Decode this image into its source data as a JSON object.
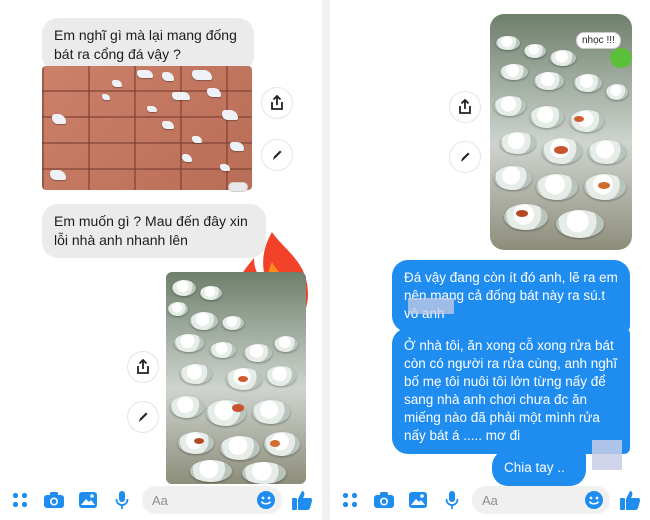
{
  "colors": {
    "accent": "#1f8cf0",
    "incoming_bubble": "#ebebeb",
    "outgoing_bubble": "#1f8cf0"
  },
  "left": {
    "messages": [
      "Em nghĩ gì mà lại mang đống bát ra cổng đá vậy ?",
      "Em muốn gì ? Mau đến đây xin lỗi nhà anh nhanh lên"
    ],
    "reaction_emoji": "🔥",
    "composer": {
      "placeholder": "Aa"
    }
  },
  "right": {
    "sticker_text": "nhọc !!!",
    "messages": [
      "Đá vậy đang còn ít đó anh, lẽ ra em nên mang cả đống bát này ra sú.t vô     anh",
      "Ở nhà tôi, ăn xong cỗ xong rửa bát còn có người ra rửa cùng, anh nghĩ bố mẹ tôi nuôi tôi lớn từng nấy để sang nhà anh chơi chưa đc ăn miếng nào đã phải một mình rửa nấy bát á ..... mơ đi",
      "Chia tay .."
    ],
    "composer": {
      "placeholder": "Aa"
    }
  },
  "icons": {
    "menu": "dots-grid-icon",
    "camera": "camera-icon",
    "gallery": "image-icon",
    "mic": "microphone-icon",
    "emoji": "smiley-icon",
    "like": "thumbs-up-icon",
    "share": "share-icon",
    "edit": "pencil-icon"
  }
}
